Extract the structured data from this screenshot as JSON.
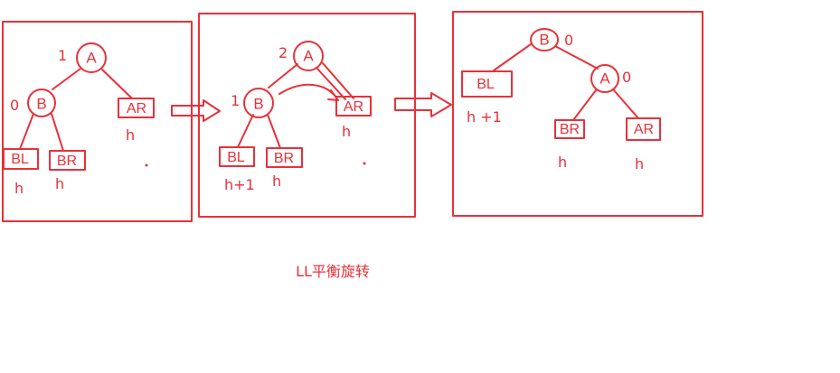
{
  "caption": "LL平衡旋转",
  "colors": {
    "stroke": "#e8313a",
    "background": "#ffffff"
  },
  "panels": [
    {
      "nodes": {
        "A": "A",
        "B": "B"
      },
      "balance": {
        "A": "1",
        "B": "0"
      },
      "subtrees": {
        "BL": "BL",
        "BR": "BR",
        "AR": "AR"
      },
      "heights": {
        "BL": "h",
        "BR": "h",
        "AR": "h"
      }
    },
    {
      "nodes": {
        "A": "A",
        "B": "B"
      },
      "balance": {
        "A": "2",
        "B": "1"
      },
      "subtrees": {
        "BL": "BL",
        "BR": "BR",
        "AR": "AR"
      },
      "heights": {
        "BL": "h+1",
        "BR": "h",
        "AR": "h"
      }
    },
    {
      "nodes": {
        "A": "A",
        "B": "B"
      },
      "balance": {
        "A": "0",
        "B": "0"
      },
      "subtrees": {
        "BL": "BL",
        "BR": "BR",
        "AR": "AR"
      },
      "heights": {
        "BL": "h +1",
        "BR": "h",
        "AR": "h"
      }
    }
  ]
}
